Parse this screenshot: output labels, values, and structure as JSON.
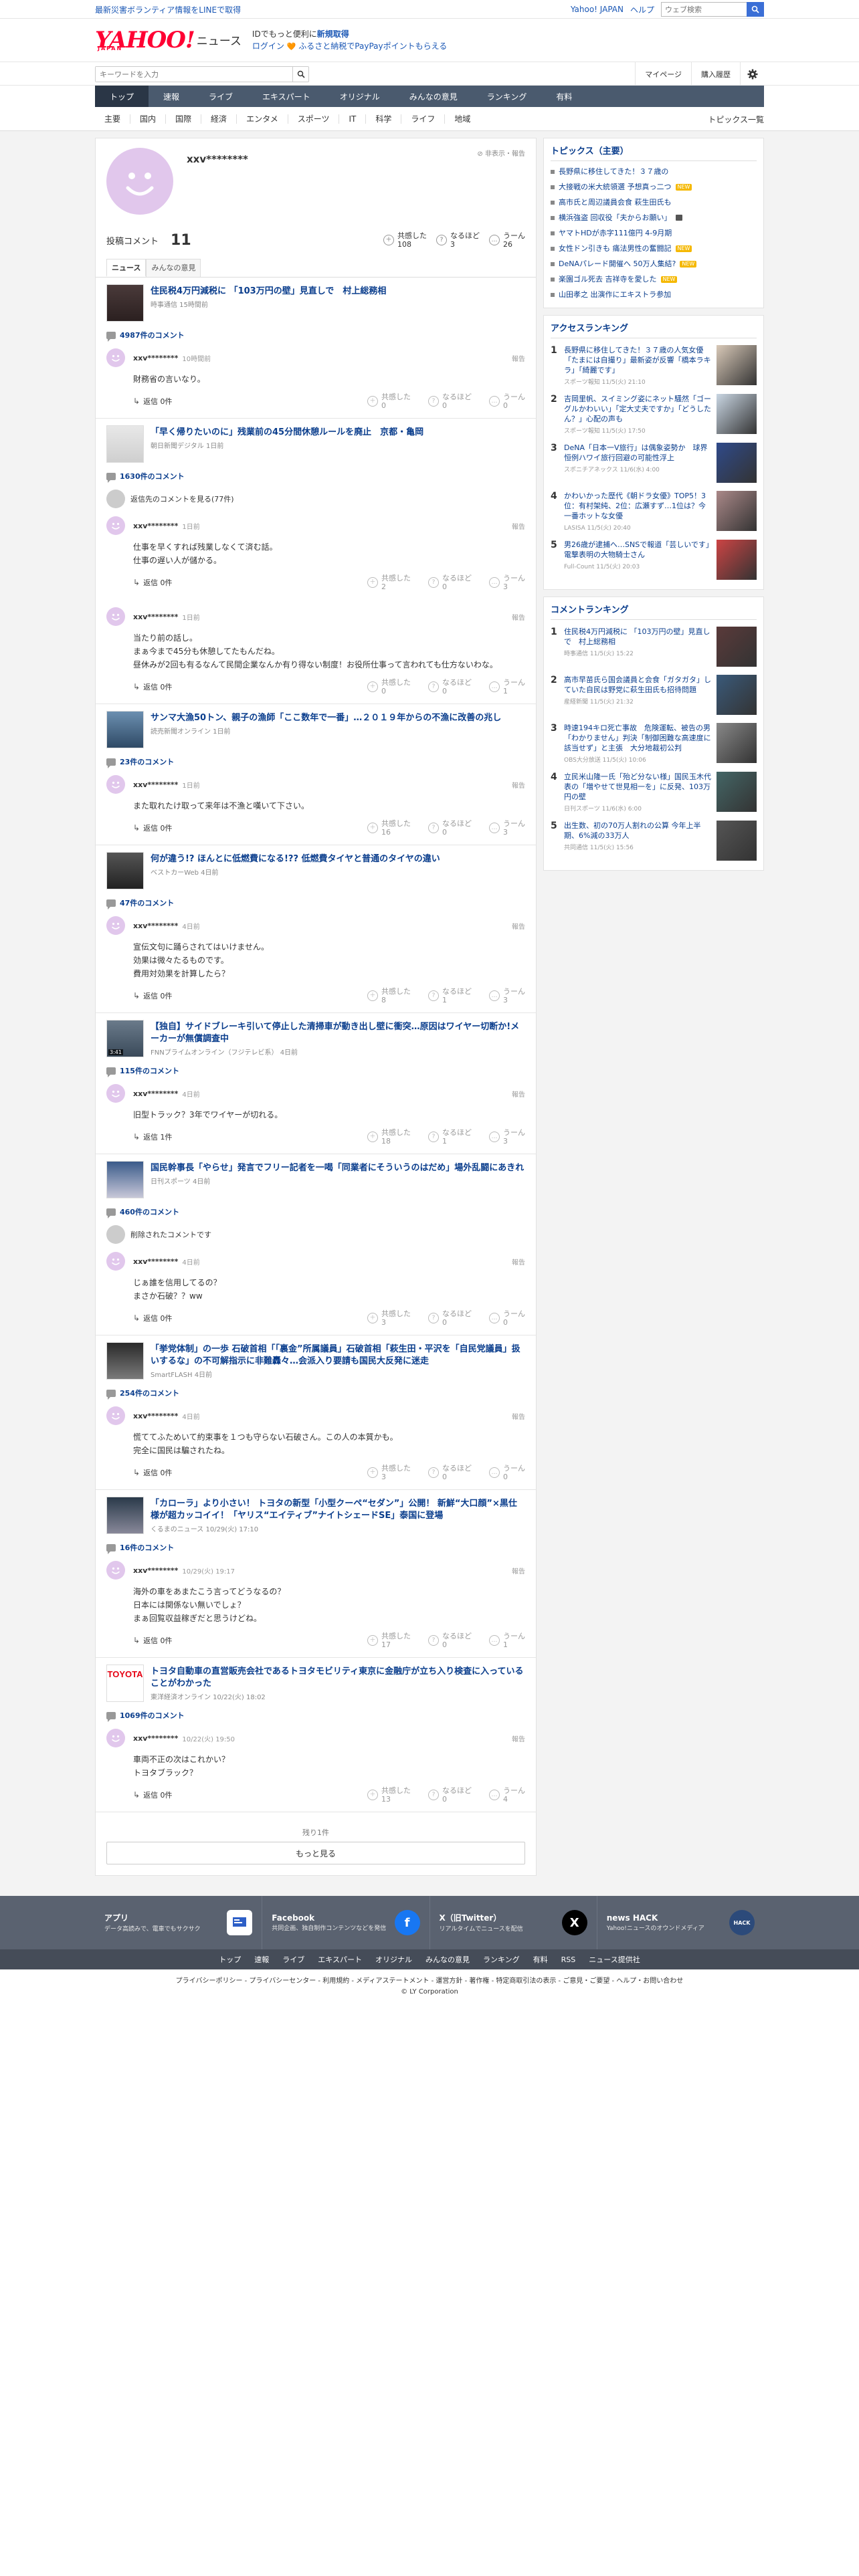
{
  "top": {
    "notice": "最新災害ボランティア情報をLINEで取得",
    "yahoo_japan": "Yahoo! JAPAN",
    "help": "ヘルプ",
    "web_search_placeholder": "ウェブ検索"
  },
  "header": {
    "logo_main": "YAHOO!",
    "logo_sub": "JAPAN",
    "logo_news": "ニュース",
    "id_line_prefix": "IDでもっと便利に",
    "id_line_link": "新規取得",
    "login": "ログイン",
    "promo": "ふるさと納税でPayPayポイントもらえる"
  },
  "search": {
    "placeholder": "キーワードを入力",
    "mypage": "マイページ",
    "history": "購入履歴"
  },
  "main_nav": [
    "トップ",
    "速報",
    "ライブ",
    "エキスパート",
    "オリジナル",
    "みんなの意見",
    "ランキング",
    "有料"
  ],
  "sub_nav": [
    "主要",
    "国内",
    "国際",
    "経済",
    "エンタメ",
    "スポーツ",
    "IT",
    "科学",
    "ライフ",
    "地域"
  ],
  "sub_nav_topics": "トピックス一覧",
  "profile": {
    "name": "xxv********",
    "report": "非表示・報告",
    "posts_label": "投稿コメント",
    "posts_count": "11",
    "reactions": [
      {
        "label": "共感した",
        "count": "108"
      },
      {
        "label": "なるほど",
        "count": "3"
      },
      {
        "label": "うーん",
        "count": "26"
      }
    ],
    "tabs": [
      "ニュース",
      "みんなの意見"
    ]
  },
  "articles": [
    {
      "title": "住民税4万円減税に 「103万円の壁」見直しで　村上総務相",
      "source": "時事通信 15時間前",
      "count": "4987件のコメント",
      "comments": [
        {
          "name": "xxv********",
          "time": "10時間前",
          "text": "財務省の言いなり。",
          "reply": "返信 0件",
          "r": [
            "0",
            "0",
            "0"
          ]
        }
      ]
    },
    {
      "title": "「早く帰りたいのに」残業前の45分間休憩ルールを廃止　京都・亀岡",
      "source": "朝日新聞デジタル 1日前",
      "count": "1630件のコメント",
      "note": "返信先のコメントを見る(77件)",
      "comments": [
        {
          "name": "xxv********",
          "time": "1日前",
          "text": "仕事を早くすれば残業しなくて済む話。\n仕事の遅い人が儲かる。",
          "reply": "返信 0件",
          "r": [
            "2",
            "0",
            "3"
          ]
        },
        {
          "name": "xxv********",
          "time": "1日前",
          "text": "当たり前の話し。\nまぁ今まで45分も休憩してたもんだね。\n昼休みが2回も有るなんて民間企業なんか有り得ない制度！お役所仕事って言われても仕方ないわな。",
          "reply": "返信 0件",
          "r": [
            "0",
            "0",
            "1"
          ]
        }
      ]
    },
    {
      "title": "サンマ大漁50トン、親子の漁師「ここ数年で一番」…２０１９年からの不漁に改善の兆し",
      "source": "読売新聞オンライン 1日前",
      "count": "23件のコメント",
      "comments": [
        {
          "name": "xxv********",
          "time": "1日前",
          "text": "また取れたけ取って来年は不漁と嘆いて下さい。",
          "reply": "返信 0件",
          "r": [
            "16",
            "0",
            "3"
          ]
        }
      ]
    },
    {
      "title": "何が違う!? ほんとに低燃費になる!?? 低燃費タイヤと普通のタイヤの違い",
      "source": "ベストカーWeb 4日前",
      "count": "47件のコメント",
      "comments": [
        {
          "name": "xxv********",
          "time": "4日前",
          "text": "宣伝文句に踊らされてはいけません。\n効果は微々たるものです。\n費用対効果を計算したら？",
          "reply": "返信 0件",
          "r": [
            "8",
            "1",
            "3"
          ]
        }
      ]
    },
    {
      "title": "【独自】サイドブレーキ引いて停止した清掃車が動き出し壁に衝突…原因はワイヤー切断か!メーカーが無償調査中",
      "source": "FNNプライムオンライン（フジテレビ系） 4日前",
      "count": "115件のコメント",
      "video": "3:41",
      "comments": [
        {
          "name": "xxv********",
          "time": "4日前",
          "text": "旧型トラック？3年でワイヤーが切れる。",
          "reply": "返信 1件",
          "r": [
            "18",
            "1",
            "3"
          ]
        }
      ]
    },
    {
      "title": "国民幹事長「やらせ」発言でフリー記者を一喝「同業者にそういうのはだめ」場外乱闘にあきれ",
      "source": "日刊スポーツ 4日前",
      "count": "460件のコメント",
      "note": "削除されたコメントです",
      "comments": [
        {
          "name": "xxv********",
          "time": "4日前",
          "text": "じぁ誰を信用してるの？\nまさか石破？？ww",
          "reply": "返信 0件",
          "r": [
            "3",
            "0",
            "0"
          ]
        }
      ]
    },
    {
      "title": "「挙党体制」の一歩 石破首相「「裏金”所属議員」石破首相「萩生田・平沢を「自民党議員」扱いするな」の不可解指示に非難轟々…会派入り要請も国民大反発に迷走",
      "source": "SmartFLASH 4日前",
      "count": "254件のコメント",
      "comments": [
        {
          "name": "xxv********",
          "time": "4日前",
          "text": "慌ててふためいて約束事を１つも守らない石破さん。この人の本質かも。\n完全に国民は騙されたね。",
          "reply": "返信 0件",
          "r": [
            "3",
            "0",
            "0"
          ]
        }
      ]
    },
    {
      "title": "「カローラ」より小さい！ トヨタの新型「小型クーペ“セダン”」公開！ 新鮮“大口顔”×黒仕様が超カッコイイ！「ヤリス“エイティブ”ナイトシェードSE」泰国に登場",
      "source": "くるまのニュース 10/29(火) 17:10",
      "count": "16件のコメント",
      "comments": [
        {
          "name": "xxv********",
          "time": "10/29(火) 19:17",
          "text": "海外の車をあまたこう言ってどうなるの？\n日本には関係ない無いでしょ？\nまぁ回覧収益稼ぎだと思うけどね。",
          "reply": "返信 0件",
          "r": [
            "17",
            "0",
            "1"
          ]
        }
      ]
    },
    {
      "title": "トヨタ自動車の直営販売会社であるトヨタモビリティ東京に金融庁が立ち入り検査に入っていることがわかった",
      "source": "東洋経済オンライン 10/22(火) 18:02",
      "count": "1069件のコメント",
      "comments": [
        {
          "name": "xxv********",
          "time": "10/22(火) 19:50",
          "text": "車両不正の次はこれかい？\nトヨタブラック？",
          "reply": "返信 0件",
          "r": [
            "13",
            "0",
            "4"
          ]
        }
      ]
    }
  ],
  "remaining": "残り1件",
  "more_button": "もっと見る",
  "sidebar": {
    "topics_title": "トピックス（主要）",
    "topics": [
      {
        "text": "長野県に移住してきた！３７歳の",
        "badge": "",
        "photo": false
      },
      {
        "text": "大接戦の米大統領選 予想真っ二つ",
        "badge": "NEW",
        "photo": false
      },
      {
        "text": "高市氏と周辺議員会食 萩生田氏も",
        "badge": "",
        "photo": false
      },
      {
        "text": "横浜強盗 回収役「夫からお願い」",
        "badge": "",
        "photo": true
      },
      {
        "text": "ヤマトHDが赤字111億円 4-9月期",
        "badge": "",
        "photo": false
      },
      {
        "text": "女性ドン引きも 痛法男性の奮闘記",
        "badge": "NEW",
        "photo": false
      },
      {
        "text": "DeNAパレード開催へ 50万人集結?",
        "badge": "NEW",
        "photo": false
      },
      {
        "text": "楽園ゴル死去 吉祥寺を愛した",
        "badge": "NEW",
        "photo": false
      },
      {
        "text": "山田孝之 出演作にエキストラ参加",
        "badge": "",
        "photo": false
      }
    ],
    "access_title": "アクセスランキング",
    "access": [
      {
        "n": "1",
        "title": "長野県に移住してきた！３７歳の人気女優「たまには自撮り」最新姿が反響「橋本ラキラ」「綺麗です」",
        "src": "スポーツ報知 11/5(火) 21:10"
      },
      {
        "n": "2",
        "title": "吉岡里帆、スイミング姿にネット騒然「ゴーグルかわいい」「定大丈夫ですか」「どうしたん？」心配の声も",
        "src": "スポーツ報知 11/5(火) 17:50"
      },
      {
        "n": "3",
        "title": "DeNA「日本一V旅行」は偶象姿勢か　球界恒例ハワイ旅行回避の可能性浮上",
        "src": "スポニチアネックス 11/6(水) 4:00"
      },
      {
        "n": "4",
        "title": "かわいかった歴代《朝ドラ女優》TOP5！3位：有村架純、2位：広瀬すず…1位は？今一番ホットな女優",
        "src": "LASISA 11/5(火) 20:40"
      },
      {
        "n": "5",
        "title": "男26歳が逮捕へ…SNSで報道「芸しいです」電撃表明の大物騎士さん",
        "src": "Full-Count 11/5(火) 20:03"
      }
    ],
    "comment_title": "コメントランキング",
    "comment_rank": [
      {
        "n": "1",
        "title": "住民税4万円減税に 「103万円の壁」見直しで　村上総務相",
        "src": "時事通信 11/5(火) 15:22"
      },
      {
        "n": "2",
        "title": "高市早苗氏ら国会議員と会食「ガタガタ」していた自民は野党に萩生田氏も招待問題",
        "src": "産経新聞 11/5(火) 21:32"
      },
      {
        "n": "3",
        "title": "時速194キロ死亡事故　危険運転、被告の男「わかりません」判決「制御困難な高速度に該当せず」と主張　大分地裁初公判",
        "src": "OBS大分放送 11/5(火) 10:06"
      },
      {
        "n": "4",
        "title": "立民米山隆一氏「殆ど分ない様」国民玉木代表の「増やせて世見相一を」に反発、103万円の壁",
        "src": "日刊スポーツ 11/6(水) 6:00"
      },
      {
        "n": "5",
        "title": "出生数、初の70万人割れの公算 今年上半期、6%減の33万人",
        "src": "共同通信 11/5(火) 15:56"
      }
    ]
  },
  "footer": {
    "sns": [
      {
        "title": "アプリ",
        "desc": "データ高読みで、電車でもサクサク"
      },
      {
        "title": "Facebook",
        "desc": "共同企画、独自制作コンテンツなどを発信"
      },
      {
        "title": "X（旧Twitter）",
        "desc": "リアルタイムでニュースを配信"
      },
      {
        "title": "news HACK",
        "desc": "Yahoo!ニュースのオウンドメディア"
      }
    ],
    "nav": [
      "トップ",
      "速報",
      "ライブ",
      "エキスパート",
      "オリジナル",
      "みんなの意見",
      "ランキング",
      "有料",
      "RSS",
      "ニュース提供社"
    ],
    "legal_links": "プライバシーポリシー - プライバシーセンター - 利用規約 - メディアステートメント - 運営方針 - 著作権 - 特定商取引法の表示 - ご意見・ご要望 - ヘルプ・お問い合わせ",
    "copyright": "© LY Corporation"
  }
}
